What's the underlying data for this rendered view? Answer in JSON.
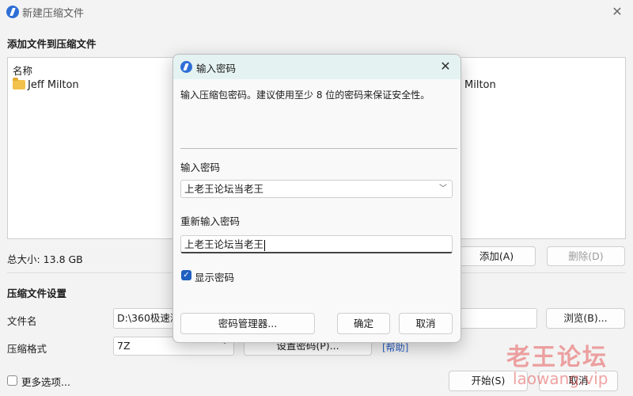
{
  "window": {
    "title": "新建压缩文件",
    "close_glyph": "✕",
    "section_add": "添加文件到压缩文件",
    "list": {
      "column_name": "名称",
      "items": [
        "Jeff Milton",
        "Milton"
      ]
    },
    "total_size": "总大小: 13.8 GB",
    "add_button": "添加(A)",
    "delete_button": "删除(D)",
    "section_settings": "压缩文件设置",
    "filename_label": "文件名",
    "filename_value": "D:\\360极速浏",
    "browse_button": "浏览(B)...",
    "format_label": "压缩格式",
    "format_value": "7Z",
    "set_password_button": "设置密码(P)...",
    "help_link": "[帮助]",
    "more_options": "更多选项...",
    "start_button": "开始(S)",
    "cancel_button": "取消"
  },
  "dialog": {
    "title": "输入密码",
    "close_glyph": "✕",
    "description": "输入压缩包密码。建议使用至少 8 位的密码来保证安全性。",
    "password_label": "输入密码",
    "password_value": "上老王论坛当老王",
    "confirm_label": "重新输入密码",
    "confirm_value": "上老王论坛当老王",
    "show_password_label": "显示密码",
    "show_password_checked": true,
    "manager_button": "密码管理器...",
    "ok_button": "确定",
    "cancel_button": "取消"
  },
  "watermark": {
    "text": "老王论坛",
    "url": "laowang.vip"
  },
  "colors": {
    "accent": "#1f5fbf",
    "dialog_titlebar": "#e4f3f1",
    "link": "#2a5fc7",
    "folder": "#f2c14b"
  }
}
